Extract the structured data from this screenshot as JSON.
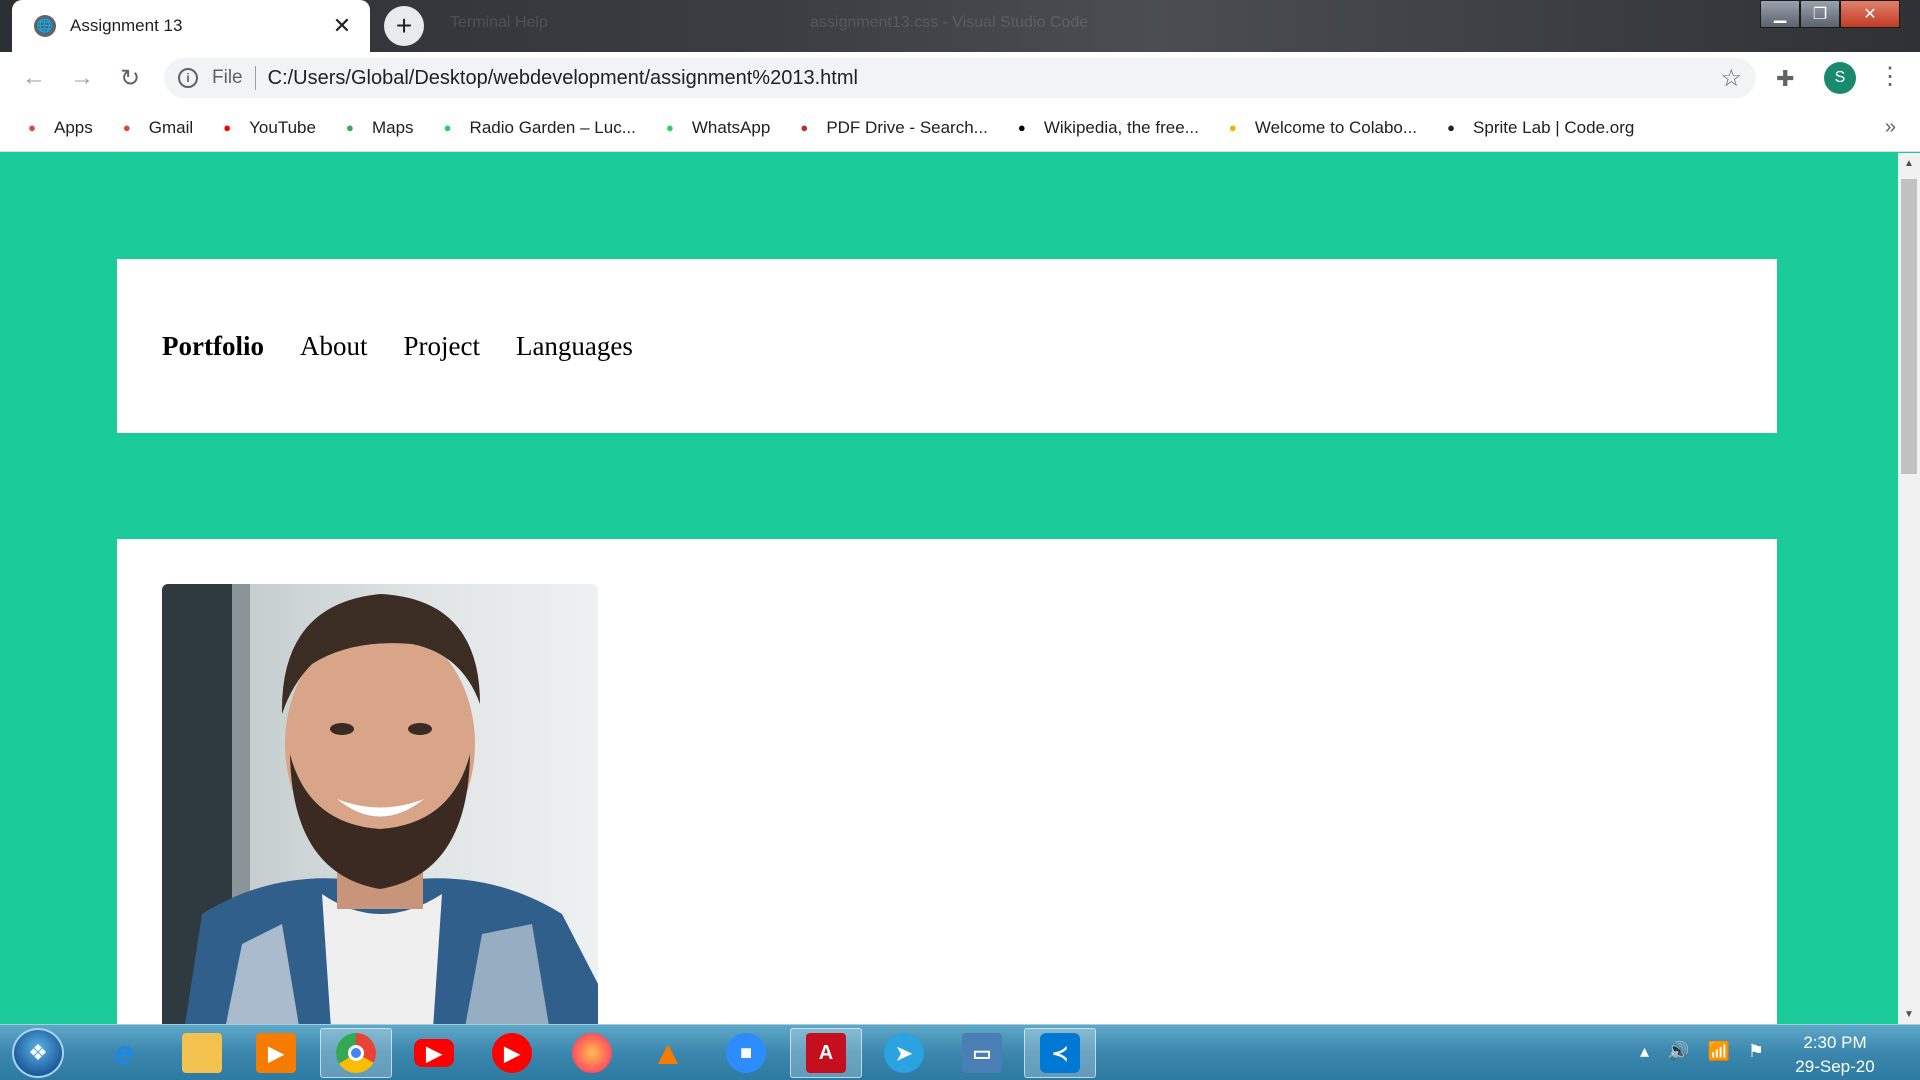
{
  "browser": {
    "tab_title": "Assignment 13",
    "close_glyph": "✕",
    "new_tab_glyph": "+",
    "ghost_left": "Terminal   Help",
    "ghost_center": "assignment13.css - Visual Studio Code",
    "scheme_label": "File",
    "url": "C:/Users/Global/Desktop/webdevelopment/assignment%2013.html",
    "profile_initial": "S",
    "window_buttons": {
      "minimize": "▁",
      "restore": "❐",
      "close": "✕"
    }
  },
  "bookmarks": [
    {
      "label": "Apps",
      "icon": "apps-icon",
      "color": "#ea4335"
    },
    {
      "label": "Gmail",
      "icon": "gmail-icon",
      "color": "#ea4335"
    },
    {
      "label": "YouTube",
      "icon": "youtube-icon",
      "color": "#ff0000"
    },
    {
      "label": "Maps",
      "icon": "maps-icon",
      "color": "#34a853"
    },
    {
      "label": "Radio Garden – Luc...",
      "icon": "radio-garden-icon",
      "color": "#1ed760"
    },
    {
      "label": "WhatsApp",
      "icon": "whatsapp-icon",
      "color": "#25d366"
    },
    {
      "label": "PDF Drive - Search...",
      "icon": "pdf-drive-icon",
      "color": "#c62828"
    },
    {
      "label": "Wikipedia, the free...",
      "icon": "wikipedia-icon",
      "color": "#000000"
    },
    {
      "label": "Welcome to Colabo...",
      "icon": "colab-icon",
      "color": "#f9ab00"
    },
    {
      "label": "Sprite Lab | Code.org",
      "icon": "code-org-icon",
      "color": "#222222"
    }
  ],
  "bookmarks_more": "»",
  "page": {
    "background": "#1ccb9a",
    "nav": {
      "brand": "Portfolio",
      "links": [
        "About",
        "Project",
        "Languages"
      ]
    }
  },
  "taskbar": {
    "time": "2:30 PM",
    "date": "29-Sep-20"
  }
}
